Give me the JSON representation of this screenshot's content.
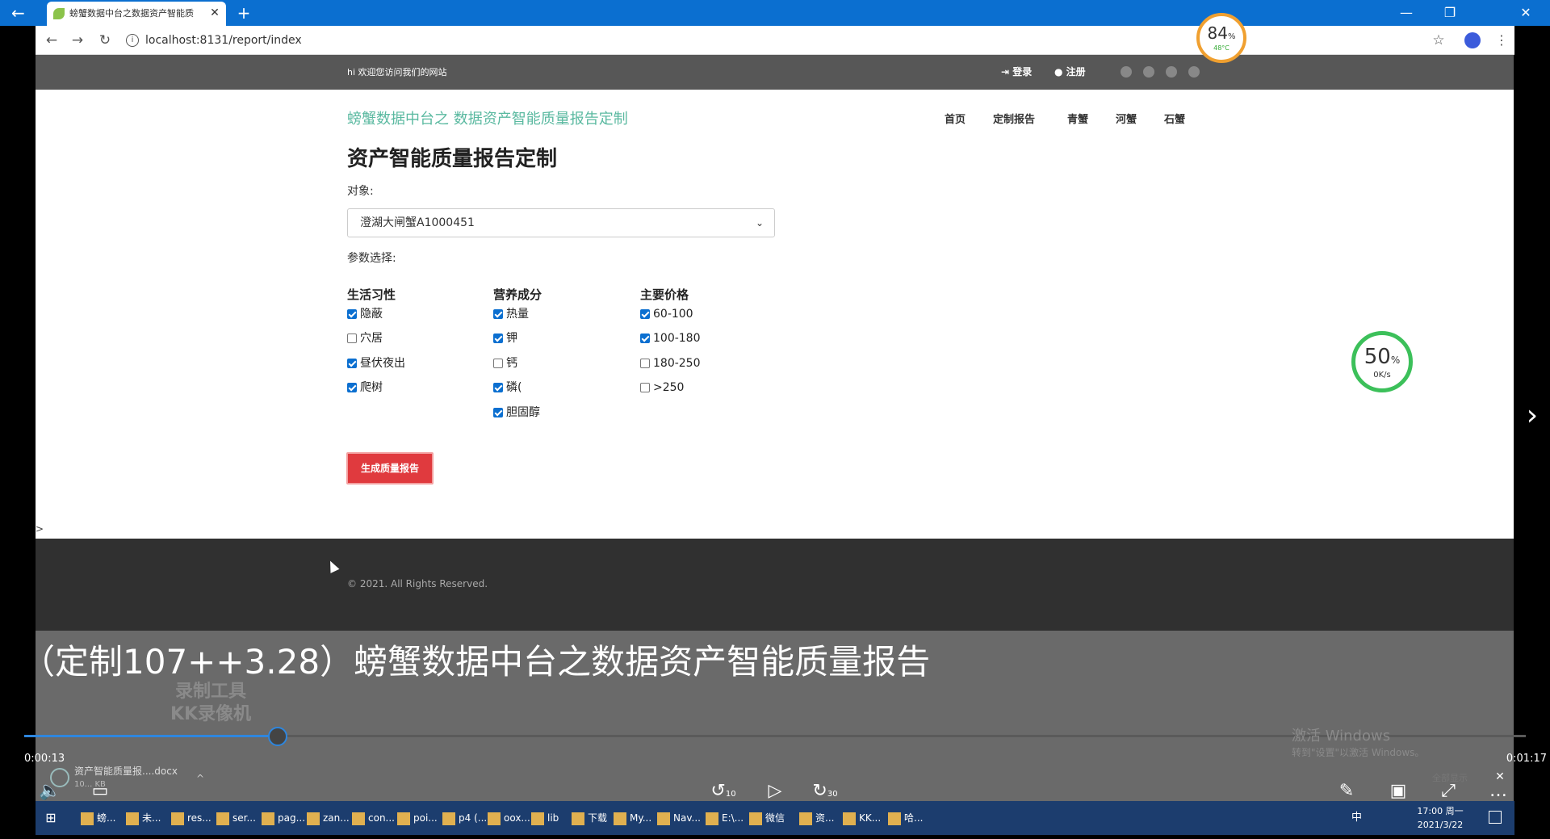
{
  "browser": {
    "tab_title": "螃蟹数据中台之数据资产智能质",
    "url": "localhost:8131/report/index",
    "new_tab": "+",
    "back": "←",
    "forward": "→",
    "reload": "↻"
  },
  "topbar": {
    "welcome": "hi 欢迎您访问我们的网站",
    "login": "登录",
    "register": "注册"
  },
  "header": {
    "site_title": "螃蟹数据中台之 数据资产智能质量报告定制",
    "menu": [
      "首页",
      "定制报告",
      "青蟹",
      "河蟹",
      "石蟹"
    ]
  },
  "form": {
    "heading": "资产智能质量报告定制",
    "object_label": "对象:",
    "object_value": "澄湖大闸蟹A1000451",
    "params_label": "参数选择:",
    "groups": [
      {
        "title": "生活习性",
        "options": [
          {
            "label": "隐蔽",
            "checked": true
          },
          {
            "label": "穴居",
            "checked": false
          },
          {
            "label": "昼伏夜出",
            "checked": true
          },
          {
            "label": "爬树",
            "checked": true
          }
        ]
      },
      {
        "title": "营养成分",
        "options": [
          {
            "label": "热量",
            "checked": true
          },
          {
            "label": "钾",
            "checked": true
          },
          {
            "label": "钙",
            "checked": false
          },
          {
            "label": "磷(",
            "checked": true
          },
          {
            "label": "胆固醇",
            "checked": true
          }
        ]
      },
      {
        "title": "主要价格",
        "options": [
          {
            "label": "60-100",
            "checked": true
          },
          {
            "label": "100-180",
            "checked": true
          },
          {
            "label": "180-250",
            "checked": false
          },
          {
            "label": ">250",
            "checked": false
          }
        ]
      }
    ],
    "generate_button": "生成质量报告"
  },
  "misc": {
    "gt": ">"
  },
  "footer": {
    "copyright": "© 2021. All Rights Reserved."
  },
  "player": {
    "title": "（定制107++3.28）螃蟹数据中台之数据资产智能质量报告",
    "watermark_line1": "录制工具",
    "watermark_line2": "KK录像机",
    "time_current": "0:00:13",
    "time_total": "0:01:17",
    "progress": 0.169,
    "skip_back": "10",
    "skip_forward": "30",
    "download_name": "资产智能质量报....docx",
    "download_size": "10... KB",
    "activate_title": "激活 Windows",
    "activate_sub": "转到\"设置\"以激活 Windows。",
    "all_display": "全部显示"
  },
  "gauges": {
    "cpu_percent": "84",
    "cpu_temp": "48°C",
    "net_percent": "50",
    "net_speed": "0K/s"
  },
  "taskbar": {
    "items": [
      "螃...",
      "未...",
      "res...",
      "ser...",
      "pag...",
      "zan...",
      "con...",
      "poi...",
      "p4 (...",
      "oox...",
      "lib",
      "下载",
      "My...",
      "Nav...",
      "E:\\...",
      "微信",
      "资...",
      "KK...",
      "哈..."
    ],
    "ime": "中",
    "clock_time": "17:00 周一",
    "clock_date": "2021/3/22"
  },
  "colors": {
    "accent": "#0b6fd0",
    "brand_title": "#5ab9a0",
    "button_red": "#e03a3e",
    "topbar_gray": "#575757",
    "footer_dark": "#303030"
  }
}
